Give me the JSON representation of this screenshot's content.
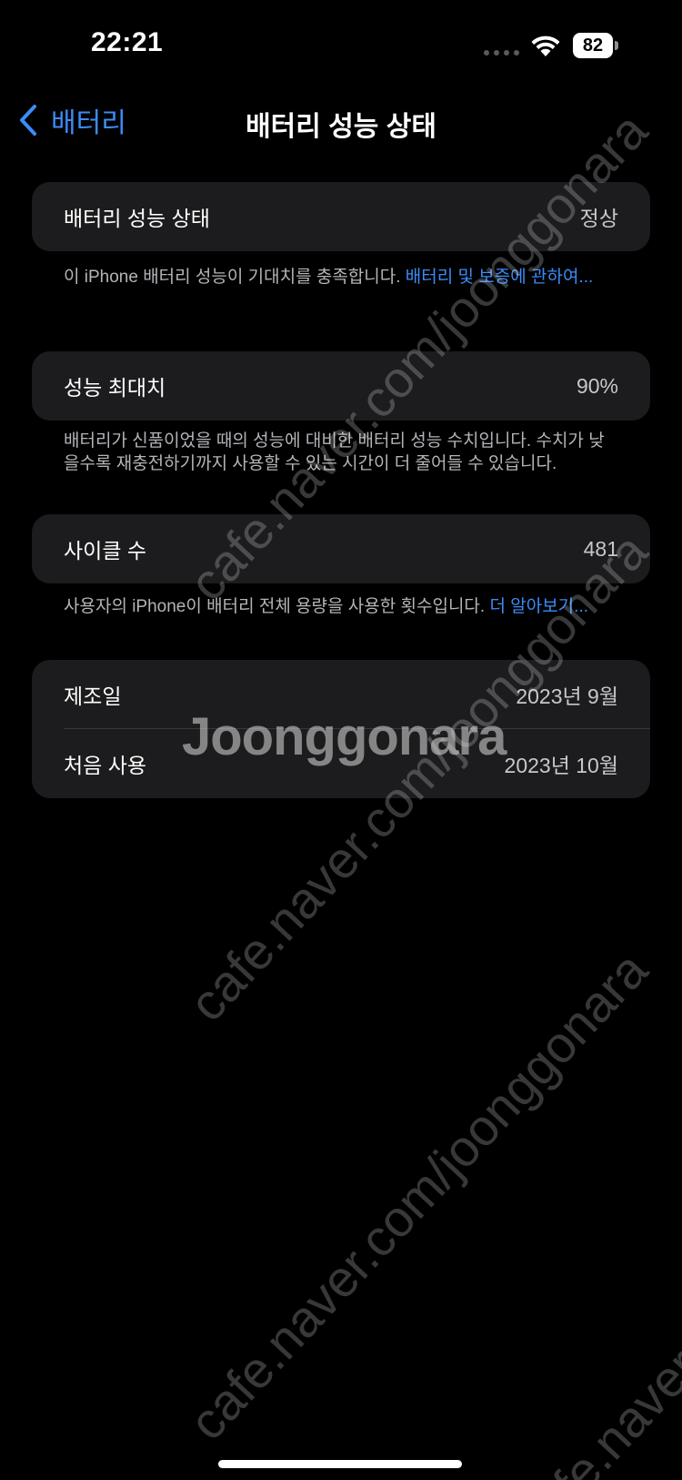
{
  "status_bar": {
    "time": "22:21",
    "battery_percent": "82",
    "icons": [
      "signal-dots-icon",
      "wifi-icon",
      "battery-icon"
    ]
  },
  "nav": {
    "back_label": "배터리",
    "title": "배터리 성능 상태"
  },
  "health": {
    "label": "배터리 성능 상태",
    "value": "정상",
    "footnote_text": "이 iPhone 배터리 성능이 기대치를 충족합니다. ",
    "footnote_link": "배터리 및 보증에 관하여..."
  },
  "max_capacity": {
    "label": "성능 최대치",
    "value": "90%",
    "footnote_text": "배터리가 신품이었을 때의 성능에 대비한 배터리 성능 수치입니다. 수치가 낮을수록 재충전하기까지 사용할 수 있는 시간이 더 줄어들 수 있습니다."
  },
  "cycle_count": {
    "label": "사이클 수",
    "value": "481",
    "footnote_text": "사용자의 iPhone이 배터리 전체 용량을 사용한 횟수입니다. ",
    "footnote_link": "더 알아보기..."
  },
  "dates": {
    "manufactured_label": "제조일",
    "manufactured_value": "2023년 9월",
    "first_use_label": "처음 사용",
    "first_use_value": "2023년 10월"
  },
  "watermark": {
    "diagonal_text": "cafe.naver.com/joonggonara",
    "logo_text": "Joonggonara"
  },
  "colors": {
    "background": "#000000",
    "card": "#1c1c1e",
    "accent": "#3b8cf7",
    "secondary_text": "#b4b4b9"
  }
}
